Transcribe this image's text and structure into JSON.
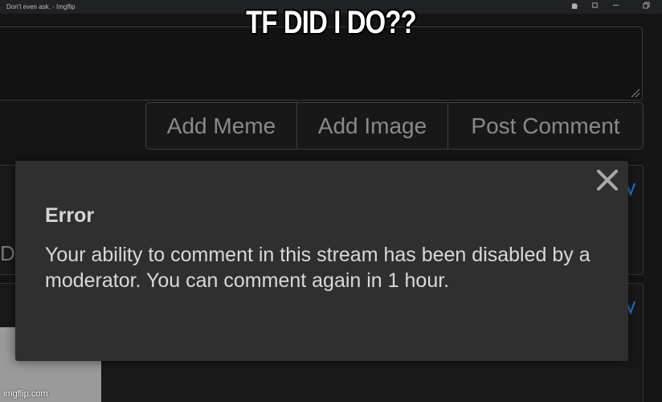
{
  "browser": {
    "tab_title": "Don't even ask. - Imgflip",
    "extensions_icon": "puzzle-icon",
    "minimize_icon": "minimize-icon",
    "restore_icon": "restore-icon"
  },
  "comment_form": {
    "textarea_value": "",
    "buttons": {
      "add_meme": "Add Meme",
      "add_image": "Add Image",
      "post_comment": "Post Comment"
    }
  },
  "background": {
    "partial_letter": "D",
    "check_icon": "check-icon"
  },
  "error_dialog": {
    "title": "Error",
    "message": "Your ability to comment in this stream has been disabled by a moderator. You can comment again in 1 hour.",
    "close_icon": "close-icon"
  },
  "meme": {
    "caption": "TF DID I DO??",
    "watermark": "imgflip.com"
  },
  "colors": {
    "background": "#151515",
    "dialog": "#2f2f2f",
    "accent_check": "#2b78d6",
    "button_text": "#8a8a8a"
  }
}
